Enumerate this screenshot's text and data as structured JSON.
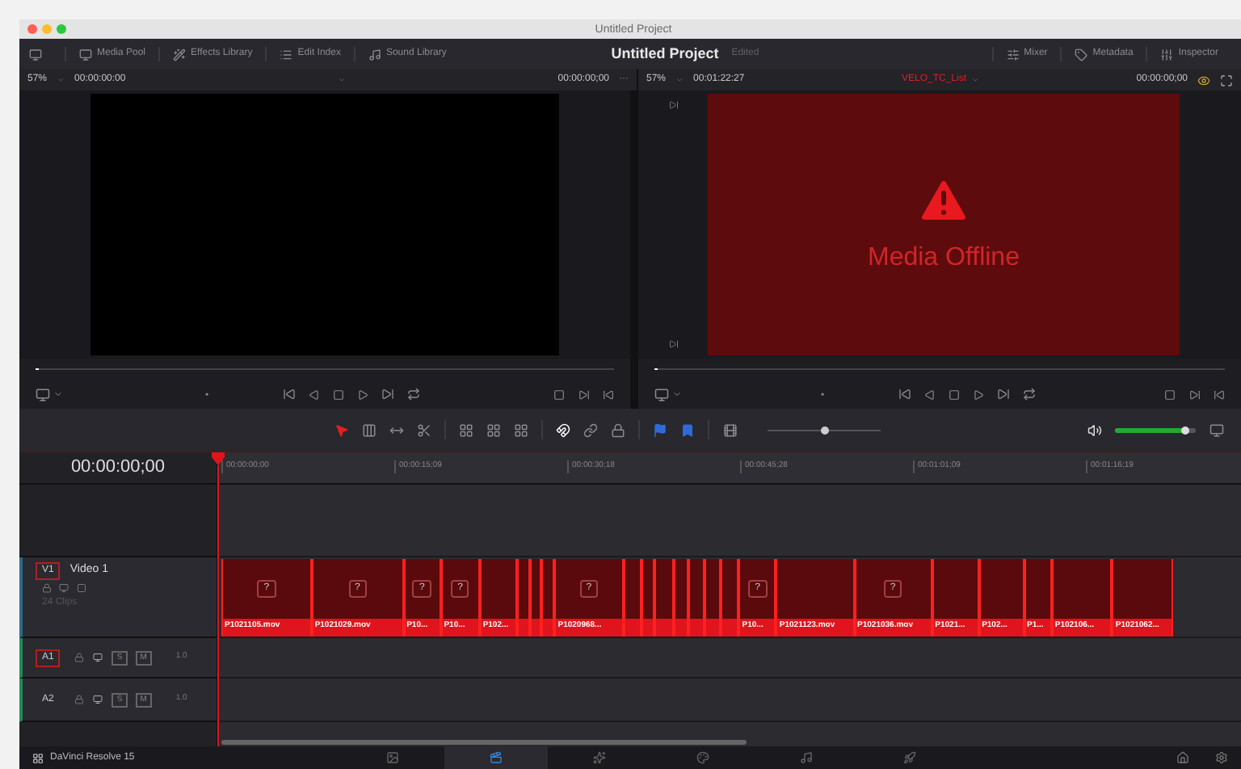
{
  "window": {
    "title": "Untitled Project"
  },
  "toolbar": {
    "left": [
      {
        "kind": "media",
        "label": "Media Pool"
      },
      {
        "kind": "effects",
        "label": "Effects Library"
      },
      {
        "kind": "index",
        "label": "Edit Index"
      },
      {
        "kind": "sound",
        "label": "Sound Library"
      }
    ],
    "project": "Untitled Project",
    "status": "Edited",
    "right": [
      {
        "kind": "mixer",
        "label": "Mixer"
      },
      {
        "kind": "metadata",
        "label": "Metadata"
      },
      {
        "kind": "inspector",
        "label": "Inspector"
      }
    ]
  },
  "source_viewer": {
    "zoom": "57%",
    "timecode": "00:00:00:00",
    "duration": "00:00:00;00",
    "more": "···"
  },
  "timeline_viewer": {
    "zoom": "57%",
    "timecode": "00:01:22:27",
    "timeline_name": "VELO_TC_List",
    "duration": "00:00:00;00",
    "offline_message": "Media Offline"
  },
  "tools": [
    {
      "kind": "select",
      "selected": true
    },
    {
      "kind": "trim",
      "selected": false
    },
    {
      "kind": "dynamic",
      "selected": false
    },
    {
      "kind": "blade",
      "selected": false
    }
  ],
  "zoom_slider": {
    "level": 0.5
  },
  "volume": {
    "level": 0.88
  },
  "timeline": {
    "timecode": "00:00:00;00",
    "ruler": [
      "00:00:00;00",
      "00:00:15;09",
      "00:00:30;18",
      "00:00:45;28",
      "00:01:01;09",
      "00:01:16;19"
    ],
    "tracks": [
      {
        "kind": "video",
        "badge": "V1",
        "name": "Video 1",
        "clip_count": "24 Clips",
        "selected": true,
        "clips": [
          {
            "name": "P1021105.mov",
            "thumb": "?",
            "offline": true
          },
          {
            "name": "P1021029.mov",
            "thumb": "?",
            "offline": true
          },
          {
            "name": "P10...",
            "thumb": "?",
            "offline": true
          },
          {
            "name": "P10...",
            "thumb": "?",
            "offline": true
          },
          {
            "name": "P102...",
            "offline": true
          },
          {
            "offline": true
          },
          {
            "offline": true
          },
          {
            "offline": true
          },
          {
            "name": "P1020968...",
            "thumb": "?",
            "offline": true
          },
          {
            "offline": true
          },
          {
            "offline": true
          },
          {
            "offline": true
          },
          {
            "offline": true
          },
          {
            "offline": true
          },
          {
            "offline": true
          },
          {
            "offline": true
          },
          {
            "name": "P10...",
            "thumb": "?",
            "offline": true
          },
          {
            "name": "P1021123.mov",
            "offline": true
          },
          {
            "name": "P1021036.mov",
            "thumb": "?",
            "offline": true
          },
          {
            "name": "P1021...",
            "offline": true
          },
          {
            "name": "P102...",
            "offline": true
          },
          {
            "name": "P1...",
            "offline": true
          },
          {
            "name": "P102106...",
            "offline": true
          },
          {
            "name": "P1021062...",
            "offline": true
          }
        ]
      },
      {
        "kind": "audio",
        "badge": "A1",
        "solo": "S",
        "mute": "M",
        "volume": "1.0",
        "selected": true
      },
      {
        "kind": "audio",
        "badge": "A2",
        "solo": "S",
        "mute": "M",
        "volume": "1.0",
        "selected": false
      }
    ]
  },
  "app": {
    "name": "DaVinci Resolve 15"
  },
  "pages": [
    {
      "kind": "media",
      "selected": false
    },
    {
      "kind": "edit",
      "selected": true
    },
    {
      "kind": "fusion",
      "selected": false
    },
    {
      "kind": "color",
      "selected": false
    },
    {
      "kind": "fairlight",
      "selected": false
    },
    {
      "kind": "deliver",
      "selected": false
    }
  ]
}
